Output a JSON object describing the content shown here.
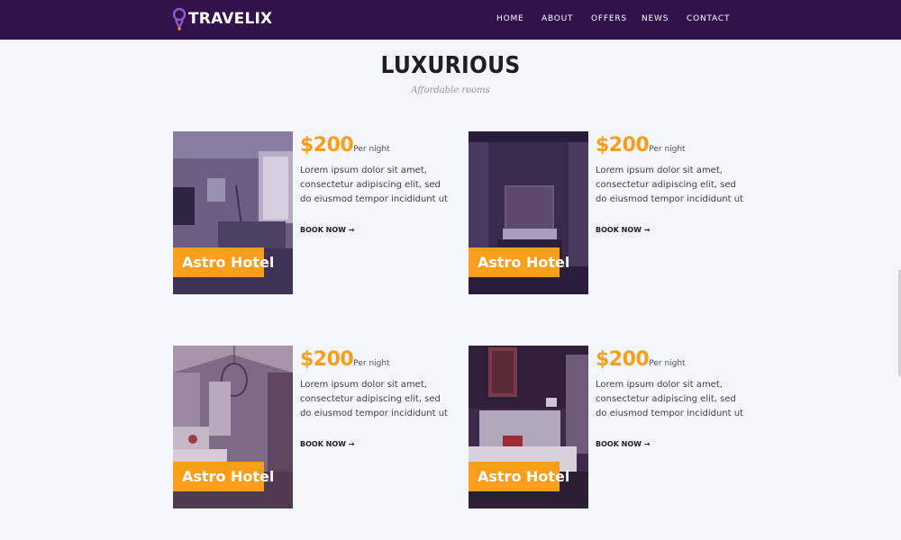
{
  "brand": {
    "name": "TRAVELIX",
    "icon": "map-pin-icon",
    "color": "#31124b"
  },
  "nav": [
    {
      "label": "HOME"
    },
    {
      "label": "ABOUT"
    },
    {
      "label": "OFFERS"
    },
    {
      "label": "NEWS"
    },
    {
      "label": "CONTACT"
    }
  ],
  "section": {
    "title": "LUXURIOUS",
    "subtitle": "Affordable rooms"
  },
  "colors": {
    "accent": "#fa9e1b",
    "navbar": "#31124b",
    "background": "#f2f5f9"
  },
  "rooms": [
    {
      "hotel": "Astro Hotel",
      "price": "$200",
      "price_unit": "Per night",
      "description": "Lorem ipsum dolor sit amet, consectetur adipiscing elit, sed do eiusmod tempor incididunt ut",
      "link": "BOOK NOW →",
      "image": "living-room-photo"
    },
    {
      "hotel": "Astro Hotel",
      "price": "$200",
      "price_unit": "Per night",
      "description": "Lorem ipsum dolor sit amet, consectetur adipiscing elit, sed do eiusmod tempor incididunt ut",
      "link": "BOOK NOW →",
      "image": "dark-bedroom-photo"
    },
    {
      "hotel": "Astro Hotel",
      "price": "$200",
      "price_unit": "Per night",
      "description": "Lorem ipsum dolor sit amet, consectetur adipiscing elit, sed do eiusmod tempor incididunt ut",
      "link": "BOOK NOW →",
      "image": "chandelier-bedroom-photo"
    },
    {
      "hotel": "Astro Hotel",
      "price": "$200",
      "price_unit": "Per night",
      "description": "Lorem ipsum dolor sit amet, consectetur adipiscing elit, sed do eiusmod tempor incididunt ut",
      "link": "BOOK NOW →",
      "image": "hotel-bed-photo"
    }
  ]
}
